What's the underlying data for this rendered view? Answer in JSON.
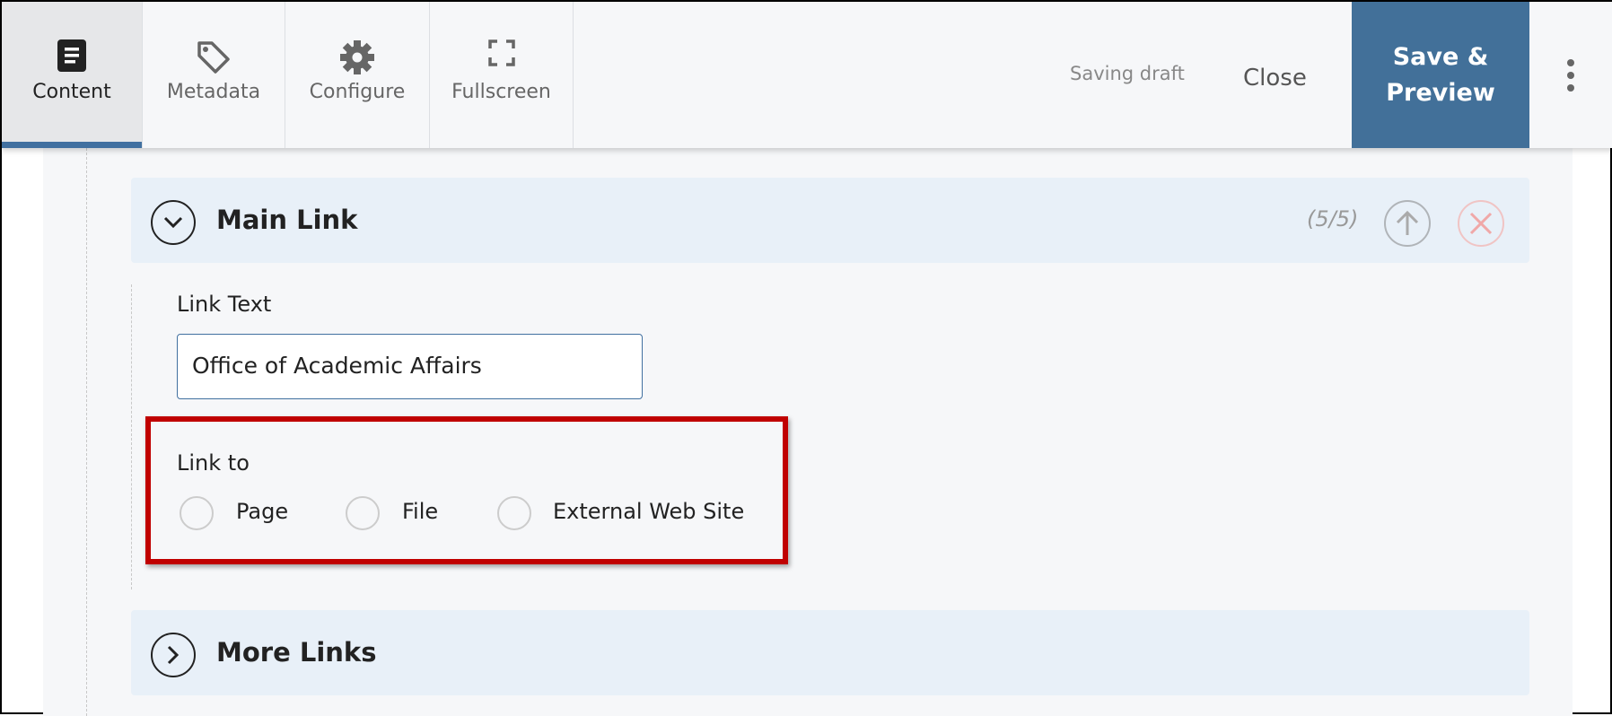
{
  "toolbar": {
    "tabs": [
      {
        "label": "Content",
        "icon": "document-icon",
        "active": true
      },
      {
        "label": "Metadata",
        "icon": "tag-icon"
      },
      {
        "label": "Configure",
        "icon": "gear-icon"
      },
      {
        "label": "Fullscreen",
        "icon": "fullscreen-icon"
      }
    ],
    "status": "Saving draft",
    "close_label": "Close",
    "save_label": "Save & Preview",
    "accent": "#427099"
  },
  "main_link": {
    "title": "Main Link",
    "count": "(5/5)",
    "link_text_label": "Link Text",
    "link_text_value": "Office of Academic Affairs",
    "link_to_label": "Link to",
    "options": [
      "Page",
      "File",
      "External Web Site"
    ]
  },
  "more_links": {
    "title": "More Links"
  },
  "highlight_color": "#c00000"
}
